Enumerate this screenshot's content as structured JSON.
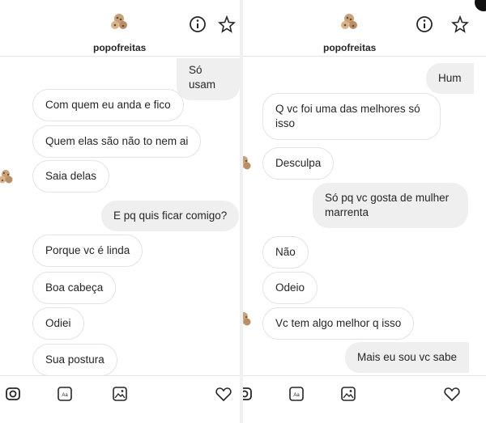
{
  "left_panel": {
    "username": "popofreitas",
    "messages": [
      {
        "text": "Só usam",
        "side": "sent"
      },
      {
        "text": "Com quem eu anda e fico",
        "side": "received"
      },
      {
        "text": "Quem elas são não to nem ai",
        "side": "received"
      },
      {
        "text": "Saia delas",
        "side": "received"
      },
      {
        "text": "E pq quis ficar comigo?",
        "side": "sent"
      },
      {
        "text": "Porque vc é linda",
        "side": "received"
      },
      {
        "text": "Boa cabeça",
        "side": "received"
      },
      {
        "text": "Odiei",
        "side": "received"
      },
      {
        "text": "Sua postura",
        "side": "received"
      }
    ]
  },
  "right_panel": {
    "username": "popofreitas",
    "messages": [
      {
        "text": "Hum",
        "side": "sent"
      },
      {
        "text": "Q vc foi uma das melhores só isso",
        "side": "received"
      },
      {
        "text": "Desculpa",
        "side": "received"
      },
      {
        "text": "Só pq vc gosta de mulher marrenta",
        "side": "sent"
      },
      {
        "text": "Não",
        "side": "received"
      },
      {
        "text": "Odeio",
        "side": "received"
      },
      {
        "text": "Vc tem algo melhor q isso",
        "side": "received"
      },
      {
        "text": "Mais eu sou vc sabe",
        "side": "sent"
      }
    ]
  },
  "icons": {
    "info": "info-icon",
    "star": "star-icon",
    "camera": "camera-icon",
    "sticker": "sticker-icon",
    "gallery": "gallery-icon",
    "heart": "heart-icon"
  },
  "colors": {
    "sent_bubble": "#efefef",
    "received_border": "#e3e3e3",
    "text": "#262626"
  }
}
